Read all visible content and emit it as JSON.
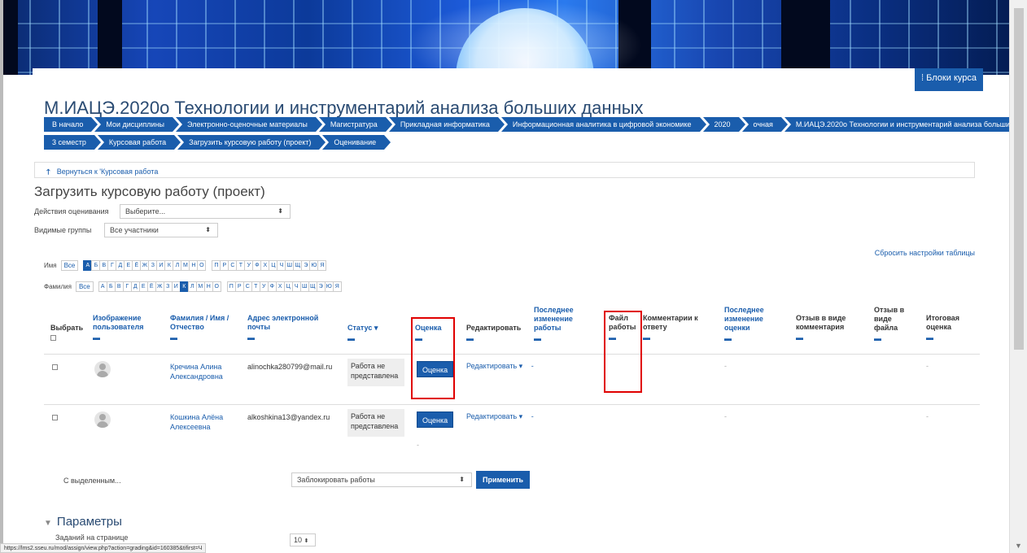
{
  "course": {
    "title": "М.ИАЦЭ.2020о Технологии и инструментарий анализа больших данных",
    "blocks_button": "Блоки курса"
  },
  "breadcrumb_row1": [
    "В начало",
    "Мои дисциплины",
    "Электронно-оценочные материалы",
    "Магистратура",
    "Прикладная информатика",
    "Информационная аналитика в цифровой экономике",
    "2020",
    "очная",
    "М.ИАЦЭ.2020о Технологии и инструментарий анализа больших данных"
  ],
  "breadcrumb_row2": [
    "3 семестр",
    "Курсовая работа",
    "Загрузить курсовую работу (проект)",
    "Оценивание"
  ],
  "back_link": "Вернуться к 'Курсовая работа",
  "page_title": "Загрузить курсовую работу (проект)",
  "grading_actions": {
    "label": "Действия оценивания",
    "value": "Выберите..."
  },
  "groups": {
    "label": "Видимые группы",
    "value": "Все участники"
  },
  "reset_table": "Сбросить настройки таблицы",
  "firstname_filter": {
    "label": "Имя",
    "all": "Все",
    "letters_a": [
      "А",
      "Б",
      "В",
      "Г",
      "Д",
      "Е",
      "Ё",
      "Ж",
      "З",
      "И",
      "К",
      "Л",
      "М",
      "Н",
      "О"
    ],
    "letters_b": [
      "П",
      "Р",
      "С",
      "Т",
      "У",
      "Ф",
      "Х",
      "Ц",
      "Ч",
      "Ш",
      "Щ",
      "Э",
      "Ю",
      "Я"
    ],
    "active": "А"
  },
  "lastname_filter": {
    "label": "Фамилия",
    "all": "Все",
    "letters_a": [
      "А",
      "Б",
      "В",
      "Г",
      "Д",
      "Е",
      "Ё",
      "Ж",
      "З",
      "И",
      "К",
      "Л",
      "М",
      "Н",
      "О"
    ],
    "letters_b": [
      "П",
      "Р",
      "С",
      "Т",
      "У",
      "Ф",
      "Х",
      "Ц",
      "Ч",
      "Ш",
      "Щ",
      "Э",
      "Ю",
      "Я"
    ],
    "active": "К"
  },
  "columns": {
    "select": "Выбрать",
    "image": "Изображение пользователя",
    "name": "Фамилия / Имя / Отчество",
    "email": "Адрес электронной почты",
    "status": "Статус",
    "grade": "Оценка",
    "edit": "Редактировать",
    "last_modified_submission": "Последнее изменение работы",
    "file": "Файл работы",
    "comments": "Комментарии к ответу",
    "last_modified_grade": "Последнее изменение оценки",
    "feedback_comment": "Отзыв в виде комментария",
    "feedback_file": "Отзыв в виде файла",
    "final_grade": "Итоговая оценка"
  },
  "rows": [
    {
      "name": "Кречина Алина Александровна",
      "email": "alinochka280799@mail.ru",
      "status": "Работа не представлена",
      "grade_button": "Оценка",
      "edit": "Редактировать"
    },
    {
      "name": "Кошкина Алёна Алексеевна",
      "email": "alkoshkina13@yandex.ru",
      "status": "Работа не представлена",
      "grade_button": "Оценка",
      "edit": "Редактировать"
    }
  ],
  "bulk": {
    "label": "С выделенным...",
    "select": "Заблокировать работы",
    "apply": "Применить"
  },
  "params": {
    "title": "Параметры",
    "per_page_label": "Заданий на странице",
    "per_page_value": "10"
  },
  "status_url": "https://lms2.sseu.ru/mod/assign/view.php?action=grading&id=160385&tifirst=Ч",
  "colors": {
    "primary": "#1a5dac",
    "highlight": "#e00000"
  }
}
